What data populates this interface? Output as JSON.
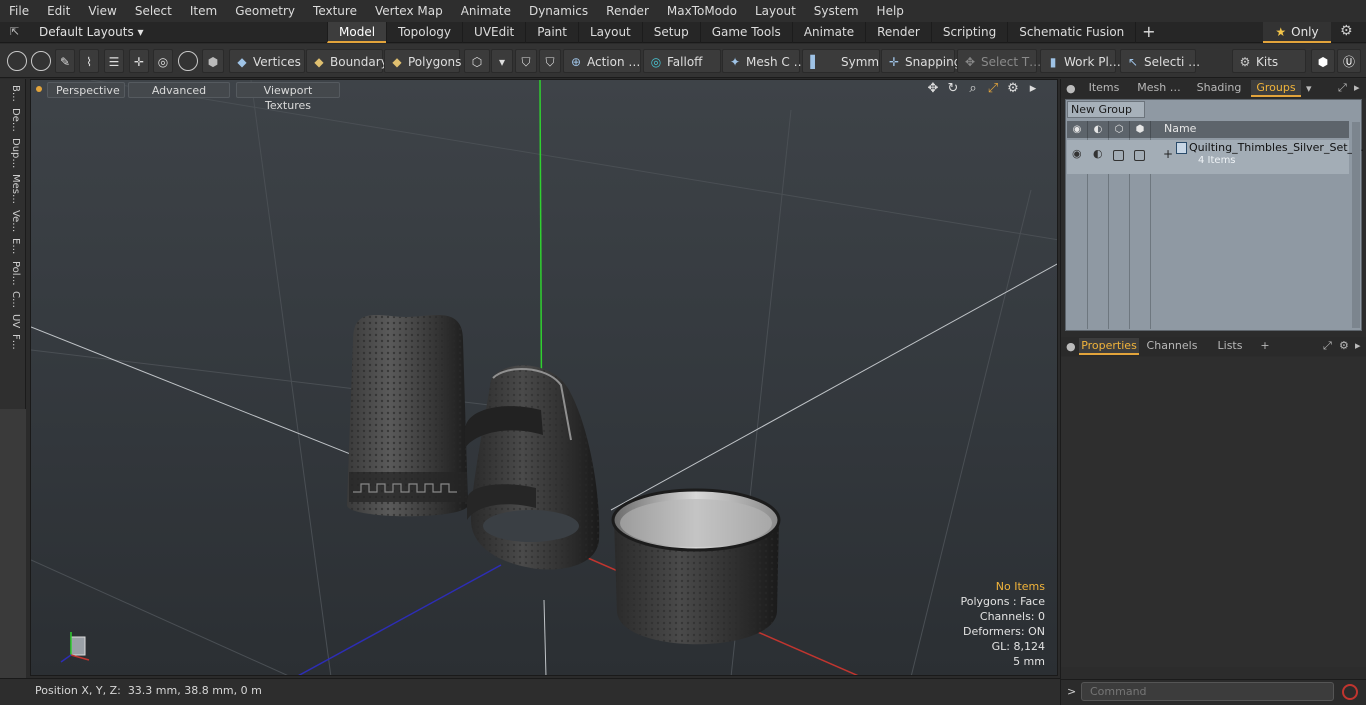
{
  "menu": [
    "File",
    "Edit",
    "View",
    "Select",
    "Item",
    "Geometry",
    "Texture",
    "Vertex Map",
    "Animate",
    "Dynamics",
    "Render",
    "MaxToModo",
    "Layout",
    "System",
    "Help"
  ],
  "layout_bar": {
    "layouts_label": "Default Layouts ▾",
    "tabs": [
      "Model",
      "Topology",
      "UVEdit",
      "Paint",
      "Layout",
      "Setup",
      "Game Tools",
      "Animate",
      "Render",
      "Scripting",
      "Schematic Fusion"
    ],
    "active_tab": "Model",
    "add_tab": "+",
    "only_label": "Only"
  },
  "toolbar": {
    "vertices": "Vertices",
    "boundary": "Boundary",
    "polygons": "Polygons",
    "action": "Action",
    "action_more": "…",
    "falloff": "Falloff",
    "mesh_c": "Mesh C …",
    "symm": "Symm …",
    "snapping": "Snapping",
    "select_t": "Select T…",
    "work_pl": "Work Pl…",
    "selecti": "Selecti …",
    "kits": "Kits"
  },
  "left_strip": [
    "B…",
    "De…",
    "Dup…",
    "Mes…",
    "Ve…",
    "E…",
    "Pol…",
    "C…",
    "UV",
    "F…"
  ],
  "viewport": {
    "view_label": "Perspective",
    "shading_label": "Advanced",
    "texture_label": "Viewport Textures",
    "info": {
      "selection": "No Items",
      "polygons": "Polygons : Face",
      "channels": "Channels: 0",
      "deformers": "Deformers: ON",
      "gl": "GL: 8,124",
      "scale": "5 mm"
    }
  },
  "status": {
    "position_label": "Position X, Y, Z:",
    "position_value": "33.3 mm, 38.8 mm, 0 m"
  },
  "right_panel": {
    "top_tabs": [
      "Items",
      "Mesh …",
      "Shading",
      "Groups"
    ],
    "active_top_tab": "Groups",
    "new_group": "New Group",
    "name_header": "Name",
    "group": {
      "name": "Quilting_Thimbles_Silver_Set_…",
      "count": "4 Items"
    },
    "bottom_tabs": [
      "Properties",
      "Channels",
      "Lists",
      "+"
    ],
    "active_bottom_tab": "Properties",
    "command_placeholder": "Command"
  },
  "colors": {
    "accent": "#e3a43b",
    "axis_x": "#c0352f",
    "axis_y": "#2fd12f",
    "axis_z": "#2d2db5"
  }
}
